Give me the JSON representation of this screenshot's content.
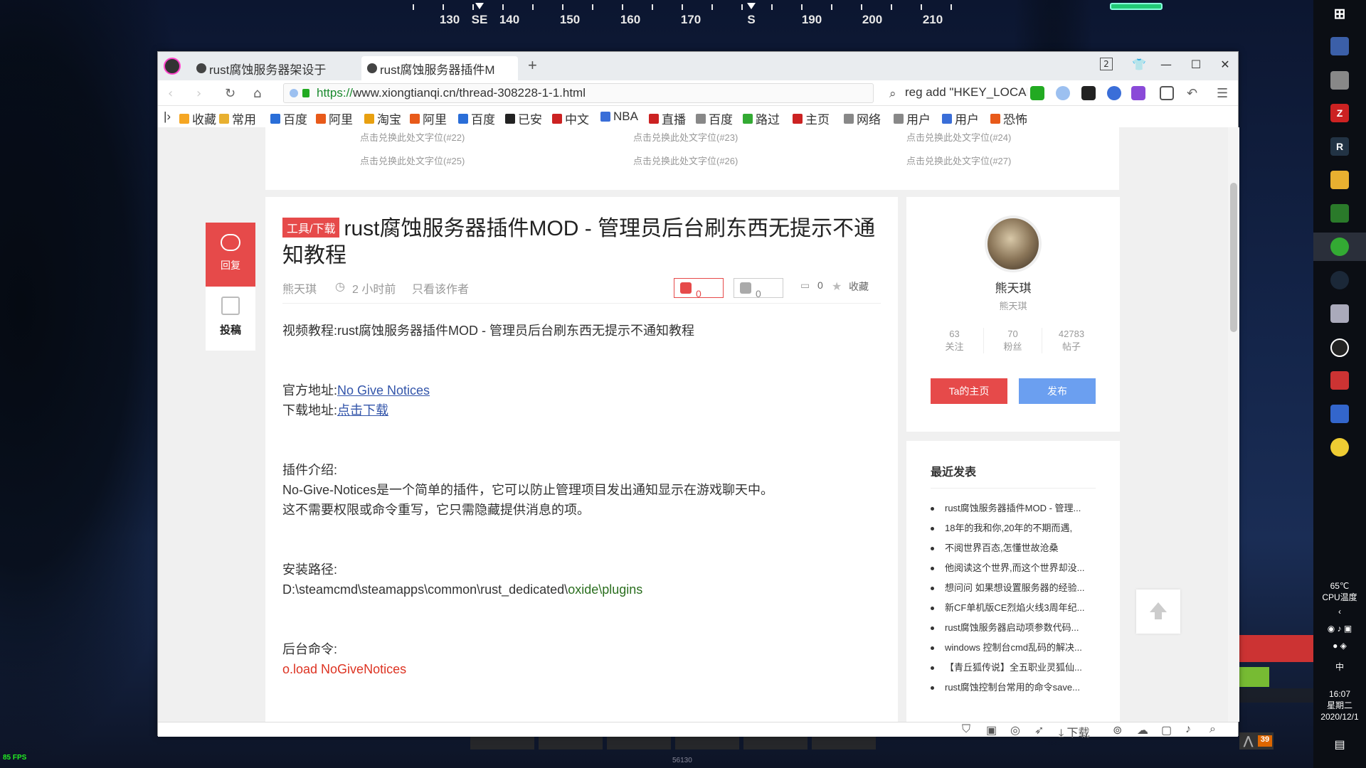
{
  "game_hud": {
    "compass_labels": [
      "130",
      "SE",
      "140",
      "150",
      "160",
      "170",
      "S",
      "190",
      "200",
      "210"
    ],
    "fps": "85 FPS",
    "hotbar_number": "56130",
    "counter": "39"
  },
  "browser": {
    "tabs": [
      {
        "label": "rust腐蚀服务器架设于"
      },
      {
        "label": "rust腐蚀服务器插件M"
      }
    ],
    "tab_count_badge": "2",
    "url_scheme": "https://",
    "url_rest": "www.xiongtianqi.cn/thread-308228-1-1.html",
    "search_text": "reg add \"HKEY_LOCAL",
    "bookmarks": [
      "收藏",
      "常用",
      "百度",
      "阿里",
      "淘宝",
      "阿里",
      "百度",
      "已安",
      "中文",
      "NBA",
      "直播",
      "百度",
      "路过",
      "主页",
      "网络",
      "用户",
      "用户",
      "恐怖"
    ],
    "status_download": "下载"
  },
  "ad_links": [
    "点击兑换此处文字位(#22)",
    "点击兑换此处文字位(#23)",
    "点击兑换此处文字位(#24)",
    "点击兑换此处文字位(#25)",
    "点击兑换此处文字位(#26)",
    "点击兑换此处文字位(#27)"
  ],
  "sidebar": {
    "reply_label": "回复",
    "post_label": "投稿"
  },
  "post": {
    "tag": "工具/下载",
    "title": "rust腐蚀服务器插件MOD - 管理员后台刷东西无提示不通知教程",
    "author": "熊天琪",
    "time": "2 小时前",
    "only_author": "只看该作者",
    "likes": "0",
    "dislikes": "0",
    "comments": "0",
    "favorite": "收藏",
    "video_line": "视频教程:rust腐蚀服务器插件MOD - 管理员后台刷东西无提示不通知教程",
    "official_label": "官方地址:",
    "official_link": "No Give Notices",
    "download_label": "下载地址:",
    "download_link": "点击下载",
    "intro_label": "插件介绍:",
    "intro_1": "No-Give-Notices是一个简单的插件，它可以防止管理项目发出通知显示在游戏聊天中。",
    "intro_2": "这不需要权限或命令重写，它只需隐藏提供消息的项。",
    "path_label": "安装路径:",
    "path_prefix": "D:\\steamcmd\\steamapps\\common\\rust_dedicated\\",
    "path_suffix": "oxide\\plugins",
    "cmd_label": "后台命令:",
    "cmd_value": "o.load NoGiveNotices"
  },
  "profile": {
    "name": "熊天琪",
    "sub": "熊天琪",
    "stats": [
      {
        "value": "63",
        "label": "关注"
      },
      {
        "value": "70",
        "label": "粉丝"
      },
      {
        "value": "42783",
        "label": "帖子"
      }
    ],
    "home_button": "Ta的主页",
    "publish_button": "发布"
  },
  "recent": {
    "title": "最近发表",
    "items": [
      "rust腐蚀服务器插件MOD - 管理...",
      "18年的我和你,20年的不期而遇,",
      "不阅世界百态,怎懂世故沧桑",
      "他阅读这个世界,而这个世界却没...",
      "想问问 如果想设置服务器的经验...",
      "新CF单机版CE烈焰火线3周年纪...",
      "rust腐蚀服务器启动项参数代码...",
      "windows 控制台cmd乱码的解决...",
      "【青丘狐传说】全五职业灵狐仙...",
      "rust腐蚀控制台常用的命令save..."
    ]
  },
  "taskbar": {
    "temp": "65℃",
    "temp_label": "CPU温度",
    "ime": "中",
    "time": "16:07",
    "weekday": "星期二",
    "date": "2020/12/1"
  },
  "colors": {
    "accent_red": "#e64a4a",
    "publish_blue": "#6b9ff0",
    "link": "#3355aa"
  }
}
